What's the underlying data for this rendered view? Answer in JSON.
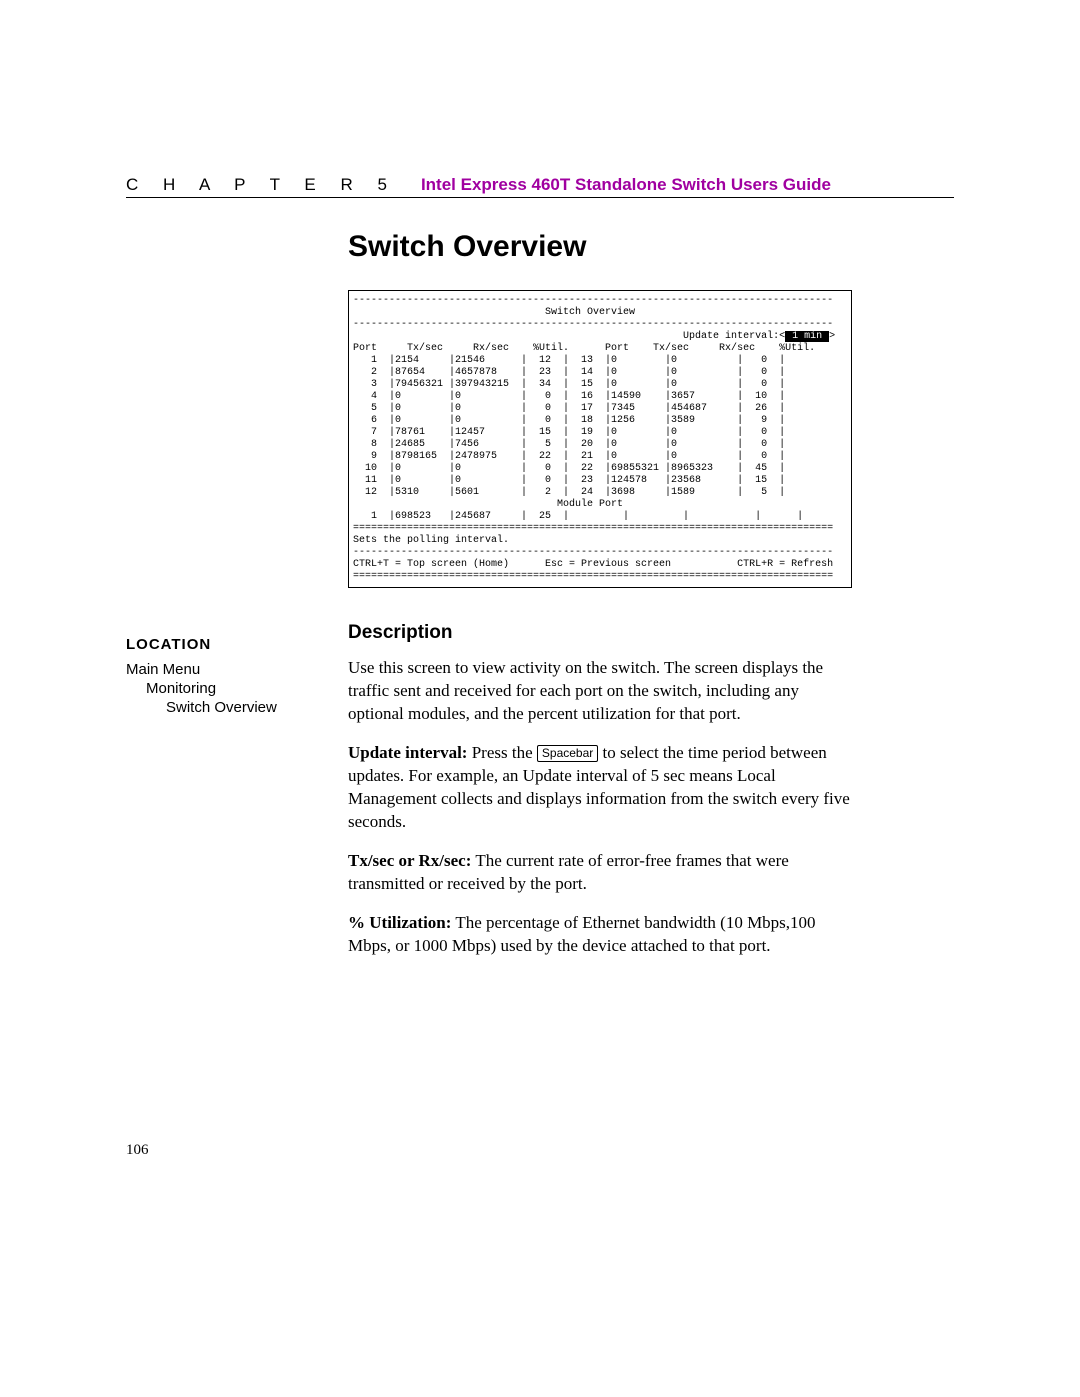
{
  "header": {
    "chapter_label": "C H A P T E R   5",
    "doc_title": "Intel Express 460T Standalone Switch Users Guide"
  },
  "section_title": "Switch Overview",
  "terminal": {
    "title": "Switch Overview",
    "update_label": "Update interval:",
    "update_value": " 1 min ",
    "col_headers_left": "Port     Tx/sec     Rx/sec    %Util.",
    "col_headers_right": "Port    Tx/sec     Rx/sec    %Util.",
    "rows_left": [
      {
        "port": "1",
        "tx": "2154",
        "rx": "21546",
        "util": "12"
      },
      {
        "port": "2",
        "tx": "87654",
        "rx": "4657878",
        "util": "23"
      },
      {
        "port": "3",
        "tx": "79456321",
        "rx": "397943215",
        "util": "34"
      },
      {
        "port": "4",
        "tx": "0",
        "rx": "0",
        "util": "0"
      },
      {
        "port": "5",
        "tx": "0",
        "rx": "0",
        "util": "0"
      },
      {
        "port": "6",
        "tx": "0",
        "rx": "0",
        "util": "0"
      },
      {
        "port": "7",
        "tx": "78761",
        "rx": "12457",
        "util": "15"
      },
      {
        "port": "8",
        "tx": "24685",
        "rx": "7456",
        "util": "5"
      },
      {
        "port": "9",
        "tx": "8798165",
        "rx": "2478975",
        "util": "22"
      },
      {
        "port": "10",
        "tx": "0",
        "rx": "0",
        "util": "0"
      },
      {
        "port": "11",
        "tx": "0",
        "rx": "0",
        "util": "0"
      },
      {
        "port": "12",
        "tx": "5310",
        "rx": "5601",
        "util": "2"
      }
    ],
    "rows_right": [
      {
        "port": "13",
        "tx": "0",
        "rx": "0",
        "util": "0"
      },
      {
        "port": "14",
        "tx": "0",
        "rx": "0",
        "util": "0"
      },
      {
        "port": "15",
        "tx": "0",
        "rx": "0",
        "util": "0"
      },
      {
        "port": "16",
        "tx": "14590",
        "rx": "3657",
        "util": "10"
      },
      {
        "port": "17",
        "tx": "7345",
        "rx": "454687",
        "util": "26"
      },
      {
        "port": "18",
        "tx": "1256",
        "rx": "3589",
        "util": "9"
      },
      {
        "port": "19",
        "tx": "0",
        "rx": "0",
        "util": "0"
      },
      {
        "port": "20",
        "tx": "0",
        "rx": "0",
        "util": "0"
      },
      {
        "port": "21",
        "tx": "0",
        "rx": "0",
        "util": "0"
      },
      {
        "port": "22",
        "tx": "69855321",
        "rx": "8965323",
        "util": "45"
      },
      {
        "port": "23",
        "tx": "124578",
        "rx": "23568",
        "util": "15"
      },
      {
        "port": "24",
        "tx": "3698",
        "rx": "1589",
        "util": "5"
      }
    ],
    "module_label": "Module Port",
    "module_row": {
      "port": "1",
      "tx": "698523",
      "rx": "245687",
      "util": "25"
    },
    "hint": "Sets the polling interval.",
    "footer_left": "CTRL+T = Top screen (Home)",
    "footer_mid": "Esc = Previous screen",
    "footer_right": "CTRL+R = Refresh"
  },
  "sidebar": {
    "heading": "Location",
    "lvl1": "Main Menu",
    "lvl2": "Monitoring",
    "lvl3": "Switch Overview"
  },
  "description": {
    "heading": "Description",
    "p1": "Use this screen to view activity on the switch. The screen displays the traffic sent and received for each port on the switch, including any optional modules, and the percent utilization for that port.",
    "p2a": "Update interval:",
    "p2b": " Press the ",
    "p2_key": "Spacebar",
    "p2c": " to select the time period between updates. For example, an Update interval of 5 sec means Local Management collects and displays information from the switch every five seconds.",
    "p3a": "Tx/sec or Rx/sec:",
    "p3b": " The current rate of error-free frames that were transmitted or received by the port.",
    "p4a": "% Utilization:",
    "p4b": " The percentage of Ethernet bandwidth (10 Mbps,100 Mbps, or 1000 Mbps) used by the device attached to that port."
  },
  "page_number": "106"
}
